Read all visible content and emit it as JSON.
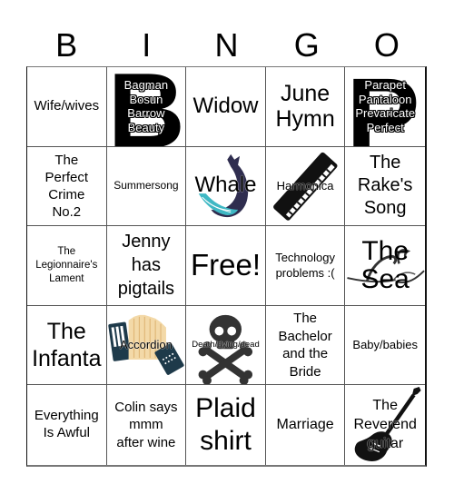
{
  "header": {
    "letters": [
      "B",
      "I",
      "N",
      "G",
      "O"
    ]
  },
  "cells": [
    {
      "text": "Wife/wives",
      "icon": null
    },
    {
      "text": "Bagman Bosun Barrow Beauty",
      "lines": [
        "Bagman",
        "Bosun",
        "Barrow",
        "Beauty"
      ],
      "icon": "letter-b-icon"
    },
    {
      "text": "Widow",
      "icon": null
    },
    {
      "text": "June Hymn",
      "lines": [
        "June",
        "Hymn"
      ],
      "icon": null
    },
    {
      "text": "Parapet Pantaloon Prevaricate Perfect",
      "lines": [
        "Parapet",
        "Pantaloon",
        "Prevaricate",
        "Perfect"
      ],
      "icon": "letter-p-icon"
    },
    {
      "text": "The Perfect Crime No.2",
      "lines": [
        "The",
        "Perfect",
        "Crime",
        "No.2"
      ],
      "icon": null
    },
    {
      "text": "Summersong",
      "icon": null
    },
    {
      "text": "Whale",
      "icon": "whale-icon"
    },
    {
      "text": "Harmonica",
      "icon": "harmonica-icon"
    },
    {
      "text": "The Rake's Song",
      "lines": [
        "The",
        "Rake's",
        "Song"
      ],
      "icon": null
    },
    {
      "text": "The Legionnaire's Lament",
      "lines": [
        "The",
        "Legionnaire's",
        "Lament"
      ],
      "icon": null
    },
    {
      "text": "Jenny has pigtails",
      "lines": [
        "Jenny",
        "has",
        "pigtails"
      ],
      "icon": null
    },
    {
      "text": "Free!",
      "icon": null
    },
    {
      "text": "Technology problems :(",
      "lines": [
        "Technology",
        "problems :("
      ],
      "icon": null
    },
    {
      "text": "The Sea",
      "lines": [
        "The",
        "Sea"
      ],
      "icon": "sea-waves-icon"
    },
    {
      "text": "The Infanta",
      "lines": [
        "The",
        "Infanta"
      ],
      "icon": null
    },
    {
      "text": "Accordion",
      "icon": "accordion-icon"
    },
    {
      "text": "Death/dying/dead",
      "icon": "skull-crossbones-icon"
    },
    {
      "text": "The Bachelor and the Bride",
      "lines": [
        "The",
        "Bachelor",
        "and the",
        "Bride"
      ],
      "icon": null
    },
    {
      "text": "Baby/babies",
      "icon": null
    },
    {
      "text": "Everything Is Awful",
      "lines": [
        "Everything",
        "Is Awful"
      ],
      "icon": null
    },
    {
      "text": "Colin says mmm after wine",
      "lines": [
        "Colin says",
        "mmm",
        "after wine"
      ],
      "icon": null
    },
    {
      "text": "Plaid shirt",
      "lines": [
        "Plaid",
        "shirt"
      ],
      "icon": null
    },
    {
      "text": "Marriage",
      "icon": null
    },
    {
      "text": "The Reverend guitar",
      "lines": [
        "The",
        "Reverend",
        "guitar"
      ],
      "icon": "electric-guitar-icon"
    }
  ],
  "colors": {
    "whale_body": "#2f2d4f",
    "whale_belly": "#3fb8c4",
    "accordion_keys": "#1e3a4a",
    "accordion_bellows": "#f3d9a8",
    "skull": "#333333"
  }
}
